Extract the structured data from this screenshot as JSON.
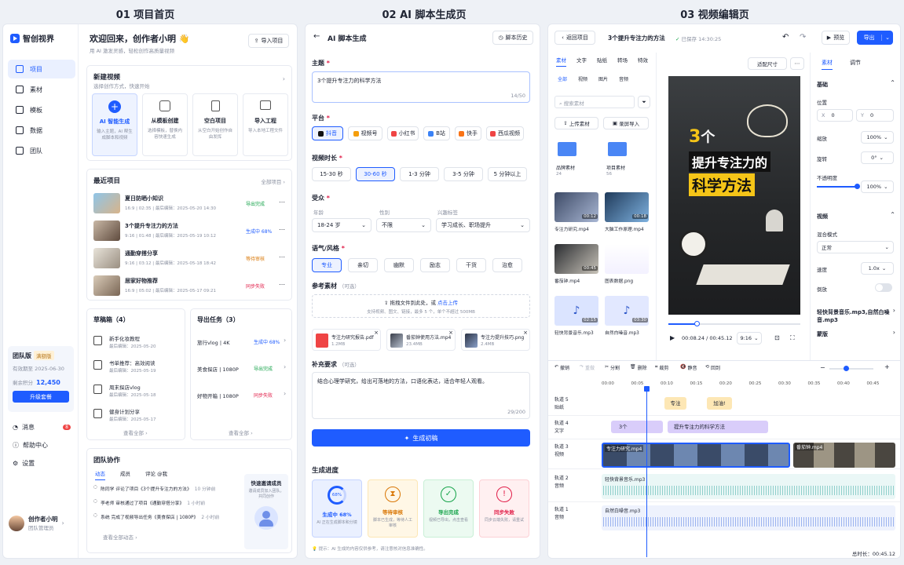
{
  "titles": {
    "p1": "01 项目首页",
    "p2": "02 AI 脚本生成页",
    "p3": "03 视频编辑页"
  },
  "sidebar": {
    "brand": "智创视界",
    "items": [
      {
        "label": "项目",
        "icon": "home-icon"
      },
      {
        "label": "素材",
        "icon": "image-icon"
      },
      {
        "label": "模板",
        "icon": "layout-icon"
      },
      {
        "label": "数据",
        "icon": "chart-icon"
      },
      {
        "label": "团队",
        "icon": "team-icon"
      }
    ],
    "plan": {
      "name": "团队版",
      "badge": "满额版",
      "expiry": "有效期至 2025-06-30",
      "points_label": "剩余积分",
      "points": "12,450",
      "upgrade": "升级套餐"
    },
    "bottom": [
      {
        "label": "消息",
        "badge": "8"
      },
      {
        "label": "帮助中心"
      },
      {
        "label": "设置"
      }
    ],
    "user": {
      "name": "创作者小明",
      "role": "团队管理员"
    }
  },
  "home": {
    "welcome": "欢迎回来，创作者小明 👋",
    "sub": "用 AI 激发灵感，轻松创作高质量视频",
    "import": "导入项目",
    "new_video": {
      "title": "新建视频",
      "sub": "选择创作方式，快速开始",
      "options": [
        {
          "t": "AI 智能生成",
          "d": "输入主题，AI 帮生成脚本和视频"
        },
        {
          "t": "从模板创建",
          "d": "选择模板，替换内容快速生成"
        },
        {
          "t": "空白项目",
          "d": "从空白开始创作自由发挥"
        },
        {
          "t": "导入工程",
          "d": "导入本地工程文件"
        }
      ]
    },
    "recent": {
      "title": "最近项目",
      "all": "全部项目 ›",
      "items": [
        {
          "name": "夏日防晒小知识",
          "meta": "16:9 | 02:35 | 最后编辑：2025-05-20 14:30",
          "status": "导出完成",
          "cls": "ok"
        },
        {
          "name": "3个提升专注力的方法",
          "meta": "9:16 | 01:48 | 最后编辑：2025-05-19 10:12",
          "status": "生成中 68%",
          "cls": "blue"
        },
        {
          "name": "通勤穿搭分享",
          "meta": "9:16 | 03:12 | 最后编辑：2025-05-18 18:42",
          "status": "等待审核",
          "cls": "warn"
        },
        {
          "name": "居家好物推荐",
          "meta": "16:9 | 05:02 | 最后编辑：2025-05-17 09:21",
          "status": "同步失败",
          "cls": "err"
        }
      ]
    },
    "drafts": {
      "title": "草稿箱（4）",
      "items": [
        {
          "n": "新手化妆教程",
          "d": "最后编辑：2025-05-20"
        },
        {
          "n": "书单推荐：高效阅读",
          "d": "最后编辑：2025-05-19"
        },
        {
          "n": "周末探店vlog",
          "d": "最后编辑：2025-05-18"
        },
        {
          "n": "健身计划分享",
          "d": "最后编辑：2025-05-17"
        }
      ],
      "all": "查看全部 ›"
    },
    "exports": {
      "title": "导出任务（3）",
      "items": [
        {
          "n": "旅行vlog | 4K",
          "s": "生成中 68%",
          "cls": "blue"
        },
        {
          "n": "美食探店 | 1080P",
          "s": "导出完成",
          "cls": "ok"
        },
        {
          "n": "好物开箱 | 1080P",
          "s": "同步失败",
          "cls": "err"
        }
      ],
      "all": "查看全部 ›"
    },
    "team": {
      "title": "团队协作",
      "tabs": [
        "动态",
        "成员",
        "评论 @我"
      ],
      "feed": [
        {
          "t": "陈同学 评论了项目《3个提升专注力的方法》",
          "time": "10 分钟前"
        },
        {
          "t": "李老师 审核通过了项目《通勤穿搭分享》",
          "time": "1 小时前"
        },
        {
          "t": "系统 完成了视频导出任务《美食探店 | 1080P》",
          "time": "2 小时前"
        }
      ],
      "more": "查看全部动态 ›",
      "invite": {
        "t": "快速邀请成员",
        "d": "邀请成员加入团队，共同创作"
      }
    }
  },
  "script": {
    "title": "AI 脚本生成",
    "history": "脚本历史",
    "topic_label": "主题",
    "topic": "3个提升专注力的科学方法",
    "counter": "14/50",
    "platform_label": "平台",
    "platforms": [
      "抖音",
      "视频号",
      "小红书",
      "B站",
      "快手",
      "西瓜视频"
    ],
    "duration_label": "视频时长",
    "durations": [
      "15-30 秒",
      "30-60 秒",
      "1-3 分钟",
      "3-5 分钟",
      "5 分钟以上"
    ],
    "aud_label": "受众",
    "age_label": "年龄",
    "age": "18-24 岁",
    "gender_label": "性别",
    "gender": "不限",
    "interest_label": "兴趣标签",
    "interest": "学习成长、职场提升",
    "tone_label": "语气/风格",
    "tones": [
      "专业",
      "亲切",
      "幽默",
      "励志",
      "干货",
      "治愈"
    ],
    "ref_label": "参考素材",
    "optional": "（可选）",
    "upload": "拖拽文件到此处，或",
    "upload_link": "点击上传",
    "upload_hint": "支持视频、图文、链接，最多 5 个，单个不超过 500MB",
    "files": [
      {
        "n": "专注力研究报告.pdf",
        "s": "1.2MB"
      },
      {
        "n": "番茄钟使用方法.mp4",
        "s": "23.4MB"
      },
      {
        "n": "专注力提升技巧.png",
        "s": "2.4MB"
      }
    ],
    "extra_label": "补充要求",
    "extra": "结合心理学研究，给出可落地的方法，口语化表达，适合年轻人观看。",
    "extra_counter": "29/200",
    "generate": "生成初稿",
    "progress_title": "生成进度",
    "steps": [
      {
        "t": "生成中 68%",
        "d": "AI 正在生成脚本和分镜",
        "pct": "68%"
      },
      {
        "t": "等待审核",
        "d": "脚本已生成，等待人工审核"
      },
      {
        "t": "导出完成",
        "d": "视频已导出，点击查看"
      },
      {
        "t": "同步失败",
        "d": "同步云端失败，请重试"
      }
    ],
    "tip": "💡 提示：AI 生成的内容仅供参考，请注意核对信息准确性。"
  },
  "editor": {
    "back": "返回项目",
    "project": "3个提升专注力的方法",
    "saved": "已保存 14:30:25",
    "preview": "预览",
    "export": "导出",
    "lib_tabs": [
      "素材",
      "文字",
      "贴纸",
      "转场",
      "特效"
    ],
    "sub_tabs": [
      "全部",
      "视频",
      "图片",
      "音频"
    ],
    "search": "搜索素材",
    "upload": "上传素材",
    "record": "录屏导入",
    "folders": [
      {
        "n": "品牌素材",
        "c": "24"
      },
      {
        "n": "项目素材",
        "c": "56"
      }
    ],
    "assets": [
      {
        "n": "专注力研究.mp4",
        "d": "00:12"
      },
      {
        "n": "大脑工作原理.mp4",
        "d": "00:18"
      },
      {
        "n": "番茄钟.mp4",
        "d": "00:45"
      },
      {
        "n": "图表数据.png",
        "d": ""
      },
      {
        "n": "轻快背景音乐.mp3",
        "d": "02:15"
      },
      {
        "n": "自然白噪音.mp3",
        "d": "03:30"
      }
    ],
    "fit": "适配尺寸",
    "video_text": {
      "l1a": "3",
      "l1b": "个",
      "l2": "提升专注力的",
      "l3": "科学方法"
    },
    "time": "00:08.24 / 00:45.12",
    "ratio": "9:16",
    "prop_tabs": [
      "素材",
      "调节"
    ],
    "basic": "基础",
    "pos": "位置",
    "x": "0",
    "y": "0",
    "scale": "缩放",
    "scale_v": "100%",
    "rotate": "旋转",
    "rotate_v": "0°",
    "opacity": "不透明度",
    "opacity_v": "100%",
    "video": "视频",
    "blend": "混合模式",
    "blend_v": "正常",
    "speed": "速度",
    "speed_v": "1.0x",
    "reverse": "倒放",
    "audio": [
      "轻快背景音乐.mp3",
      "自然白噪音.mp3"
    ],
    "mask": "蒙版",
    "tools": [
      "撤销",
      "重做",
      "分割",
      "删除",
      "裁剪",
      "静音",
      "回到"
    ],
    "ruler": [
      "00:00",
      "00:05",
      "00:10",
      "00:15",
      "00:20",
      "00:25",
      "00:30",
      "00:35",
      "00:40",
      "00:45"
    ],
    "tracks": [
      {
        "t": "轨道 5",
        "s": "贴纸"
      },
      {
        "t": "轨道 4",
        "s": "文字"
      },
      {
        "t": "轨道 3",
        "s": "视频"
      },
      {
        "t": "轨道 2",
        "s": "音频"
      },
      {
        "t": "轨道 1",
        "s": "音频"
      }
    ],
    "stickers": [
      "专注",
      "加油!"
    ],
    "texts": [
      "3个",
      "提升专注力的科学方法"
    ],
    "clips": [
      "专注力研究.mp4",
      "番茄钟.mp4"
    ],
    "total": "总时长：00:45.12"
  }
}
